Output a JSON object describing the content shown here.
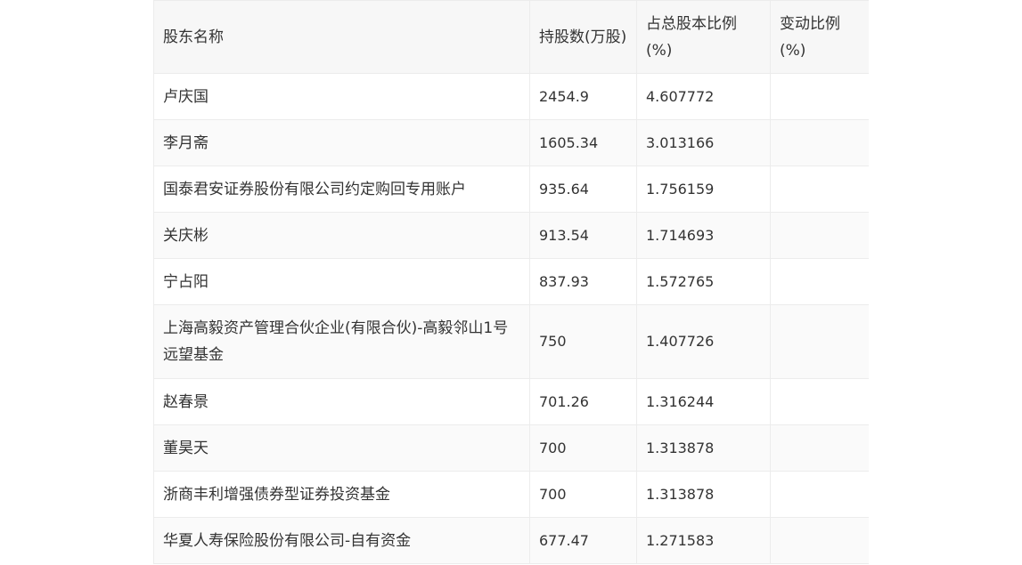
{
  "table": {
    "headers": [
      "股东名称",
      "持股数(万股)",
      "占总股本比例(%)",
      "变动比例(%)"
    ],
    "rows": [
      {
        "name": "卢庆国",
        "shares": "2454.9",
        "ratio": "4.607772",
        "change": ""
      },
      {
        "name": "李月斋",
        "shares": "1605.34",
        "ratio": "3.013166",
        "change": ""
      },
      {
        "name": "国泰君安证券股份有限公司约定购回专用账户",
        "shares": "935.64",
        "ratio": "1.756159",
        "change": ""
      },
      {
        "name": "关庆彬",
        "shares": "913.54",
        "ratio": "1.714693",
        "change": ""
      },
      {
        "name": "宁占阳",
        "shares": "837.93",
        "ratio": "1.572765",
        "change": ""
      },
      {
        "name": "上海高毅资产管理合伙企业(有限合伙)-高毅邻山1号远望基金",
        "shares": "750",
        "ratio": "1.407726",
        "change": ""
      },
      {
        "name": "赵春景",
        "shares": "701.26",
        "ratio": "1.316244",
        "change": ""
      },
      {
        "name": "董昊天",
        "shares": "700",
        "ratio": "1.313878",
        "change": ""
      },
      {
        "name": "浙商丰利增强债券型证券投资基金",
        "shares": "700",
        "ratio": "1.313878",
        "change": ""
      },
      {
        "name": "华夏人寿保险股份有限公司-自有资金",
        "shares": "677.47",
        "ratio": "1.271583",
        "change": ""
      }
    ]
  }
}
